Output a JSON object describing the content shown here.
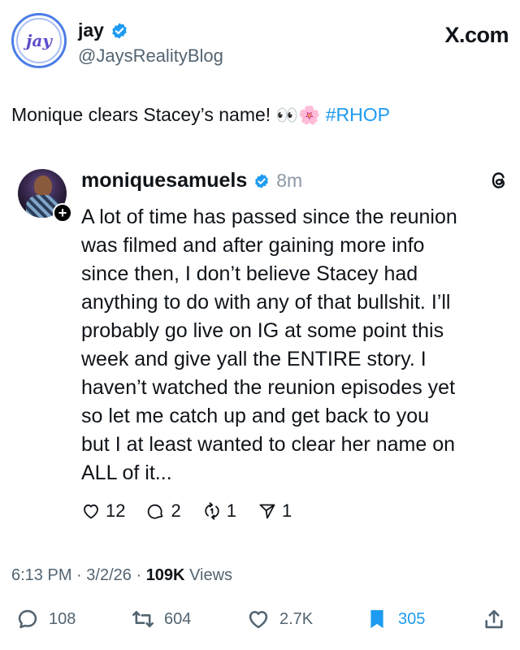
{
  "author": {
    "display_name": "jay",
    "handle": "@JaysRealityBlog",
    "avatar_text": "jay",
    "verified": true
  },
  "brand": "X.com",
  "tweet": {
    "text_before": "Monique clears Stacey’s name! ",
    "emoji": "👀🌸",
    "hashtag": "#RHOP"
  },
  "embedded": {
    "display_name": "moniquesamuels",
    "time": "8m",
    "verified": true,
    "lines": [
      "A lot of time has passed since the reunion",
      "was filmed and after gaining more info",
      "since then, I don’t believe Stacey had",
      "anything to do with any of that bullshit. I’ll",
      "probably go live on IG at some point this",
      "week and give yall the ENTIRE story. I",
      "haven’t watched the reunion episodes yet",
      "so let me catch up and get back to you",
      "but I at least wanted to clear her name on",
      "ALL of it..."
    ],
    "actions": {
      "likes": "12",
      "replies": "2",
      "reposts": "1",
      "shares": "1"
    }
  },
  "meta": {
    "time": "6:13 PM",
    "date": "3/2/26",
    "views_count": "109K",
    "views_label": "Views"
  },
  "bottom_bar": {
    "replies": "108",
    "reposts": "604",
    "likes": "2.7K",
    "bookmarks": "305"
  },
  "colors": {
    "accent": "#1d9bf0",
    "text": "#0f1419",
    "muted": "#536471"
  }
}
